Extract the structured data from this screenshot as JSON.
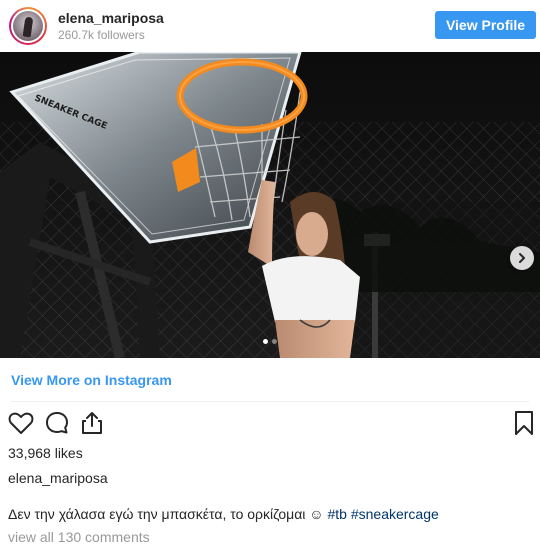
{
  "header": {
    "username": "elena_mariposa",
    "followers": "260.7k followers",
    "view_profile_label": "View Profile"
  },
  "photo": {
    "backboard_text": "SNEAKER CAGE",
    "carousel": {
      "slides": 2,
      "active": 1
    }
  },
  "links": {
    "view_more": "View More on Instagram"
  },
  "post": {
    "likes": "33,968 likes",
    "poster": "elena_mariposa",
    "caption_text": "Δεν την χάλασα εγώ την μπασκέτα, το ορκίζομαι ☺",
    "hashtags": [
      "#tb",
      "#sneakercage"
    ],
    "comments_link": "view all 130 comments"
  },
  "icons": [
    "heart-icon",
    "comment-icon",
    "share-icon",
    "bookmark-icon",
    "chevron-right-icon"
  ],
  "colors": {
    "accent": "#3897f0",
    "hashtag": "#003569",
    "muted": "#999999",
    "hoop": "#f28a1e"
  }
}
